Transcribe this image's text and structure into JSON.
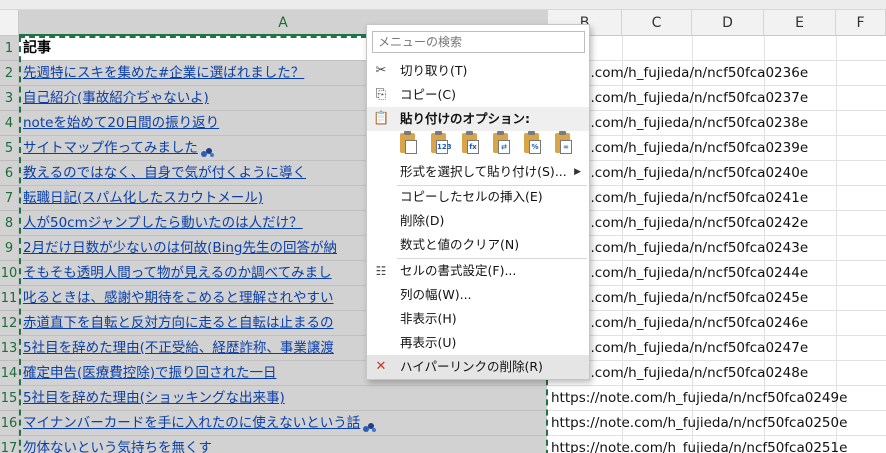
{
  "columns": [
    "A",
    "B",
    "C",
    "D",
    "E",
    "F"
  ],
  "rows": [
    {
      "num": "1",
      "title": "記事",
      "url": ""
    },
    {
      "num": "2",
      "title": "先週特にスキを集めた#企業に選ばれました？",
      "url": "//note.com/h_fujieda/n/ncf50fca0236e"
    },
    {
      "num": "3",
      "title": "自己紹介(事故紹介ぢゃないよ)",
      "url": "//note.com/h_fujieda/n/ncf50fca0237e"
    },
    {
      "num": "4",
      "title": "noteを始めて20日間の振り返り",
      "url": "//note.com/h_fujieda/n/ncf50fca0238e"
    },
    {
      "num": "5",
      "title": "サイトマップ作ってみました",
      "url": "//note.com/h_fujieda/n/ncf50fca0239e"
    },
    {
      "num": "6",
      "title": "教えるのではなく、自身で気が付くように導く",
      "url": "//note.com/h_fujieda/n/ncf50fca0240e"
    },
    {
      "num": "7",
      "title": "転職日記(スパム化したスカウトメール)",
      "url": "//note.com/h_fujieda/n/ncf50fca0241e"
    },
    {
      "num": "8",
      "title": "人が50cmジャンプしたら動いたのは人だけ？",
      "url": "//note.com/h_fujieda/n/ncf50fca0242e"
    },
    {
      "num": "9",
      "title": "2月だけ日数が少ないのは何故(Bing先生の回答が納",
      "url": "//note.com/h_fujieda/n/ncf50fca0243e"
    },
    {
      "num": "10",
      "title": "そもそも透明人間って物が見えるのか調べてみまし",
      "url": "//note.com/h_fujieda/n/ncf50fca0244e"
    },
    {
      "num": "11",
      "title": "叱るときは、感謝や期待をこめると理解されやすい",
      "url": "//note.com/h_fujieda/n/ncf50fca0245e"
    },
    {
      "num": "12",
      "title": "赤道直下を自転と反対方向に走ると自転は止まるの",
      "url": "//note.com/h_fujieda/n/ncf50fca0246e"
    },
    {
      "num": "13",
      "title": "5社目を辞めた理由(不正受給、経歴詐称、事業譲渡",
      "url": "//note.com/h_fujieda/n/ncf50fca0247e"
    },
    {
      "num": "14",
      "title": "確定申告(医療費控除)で振り回された一日",
      "url": "//note.com/h_fujieda/n/ncf50fca0248e"
    },
    {
      "num": "15",
      "title": "5社目を辞めた理由(ショッキングな出来事)",
      "url": "https://note.com/h_fujieda/n/ncf50fca0249e"
    },
    {
      "num": "16",
      "title": "マイナンバーカードを手に入れたのに使えないという話",
      "url": "https://note.com/h_fujieda/n/ncf50fca0250e"
    },
    {
      "num": "17",
      "title": "勿体ないという気持ちを無くす",
      "url": "https://note.com/h_fujieda/n/ncf50fca0251e"
    }
  ],
  "context_menu": {
    "search_placeholder": "メニューの検索",
    "cut": "切り取り(T)",
    "copy": "コピー(C)",
    "paste_options": "貼り付けのオプション:",
    "paste_special": "形式を選択して貼り付け(S)...",
    "insert_copied": "コピーしたセルの挿入(E)",
    "delete": "削除(D)",
    "clear_contents": "数式と値のクリア(N)",
    "format_cells": "セルの書式設定(F)...",
    "column_width": "列の幅(W)...",
    "hide": "非表示(H)",
    "unhide": "再表示(U)",
    "remove_hyperlinks": "ハイパーリンクの削除(R)",
    "paste_icons": [
      "paste-icon",
      "paste-values-icon",
      "paste-formulas-icon",
      "paste-transpose-icon",
      "paste-formatting-icon",
      "paste-link-icon"
    ],
    "paste_icon_labels": [
      "",
      "123",
      "fx",
      "⇄",
      "%",
      "∞"
    ]
  },
  "colors": {
    "selection_green": "#217346",
    "link_blue": "#0b3fa8",
    "selected_fill": "#d2d2d2"
  }
}
